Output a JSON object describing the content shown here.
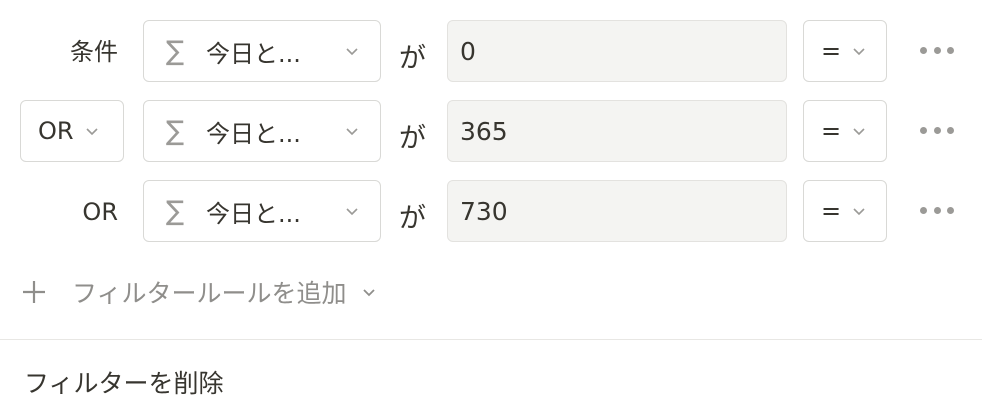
{
  "rules": [
    {
      "label": "条件",
      "conjunction": null,
      "property": "今日と...",
      "connector": "が",
      "value": "0",
      "operator": "="
    },
    {
      "label": null,
      "conjunction": "OR",
      "property": "今日と...",
      "connector": "が",
      "value": "365",
      "operator": "="
    },
    {
      "label": "OR",
      "conjunction": null,
      "property": "今日と...",
      "connector": "が",
      "value": "730",
      "operator": "="
    }
  ],
  "add_rule_label": "フィルタールールを追加",
  "delete_filter_label": "フィルターを削除",
  "icons": {
    "property_icon": "sigma-icon",
    "chevron": "chevron-down-icon",
    "more": "more-horizontal-icon",
    "add": "plus-icon"
  }
}
